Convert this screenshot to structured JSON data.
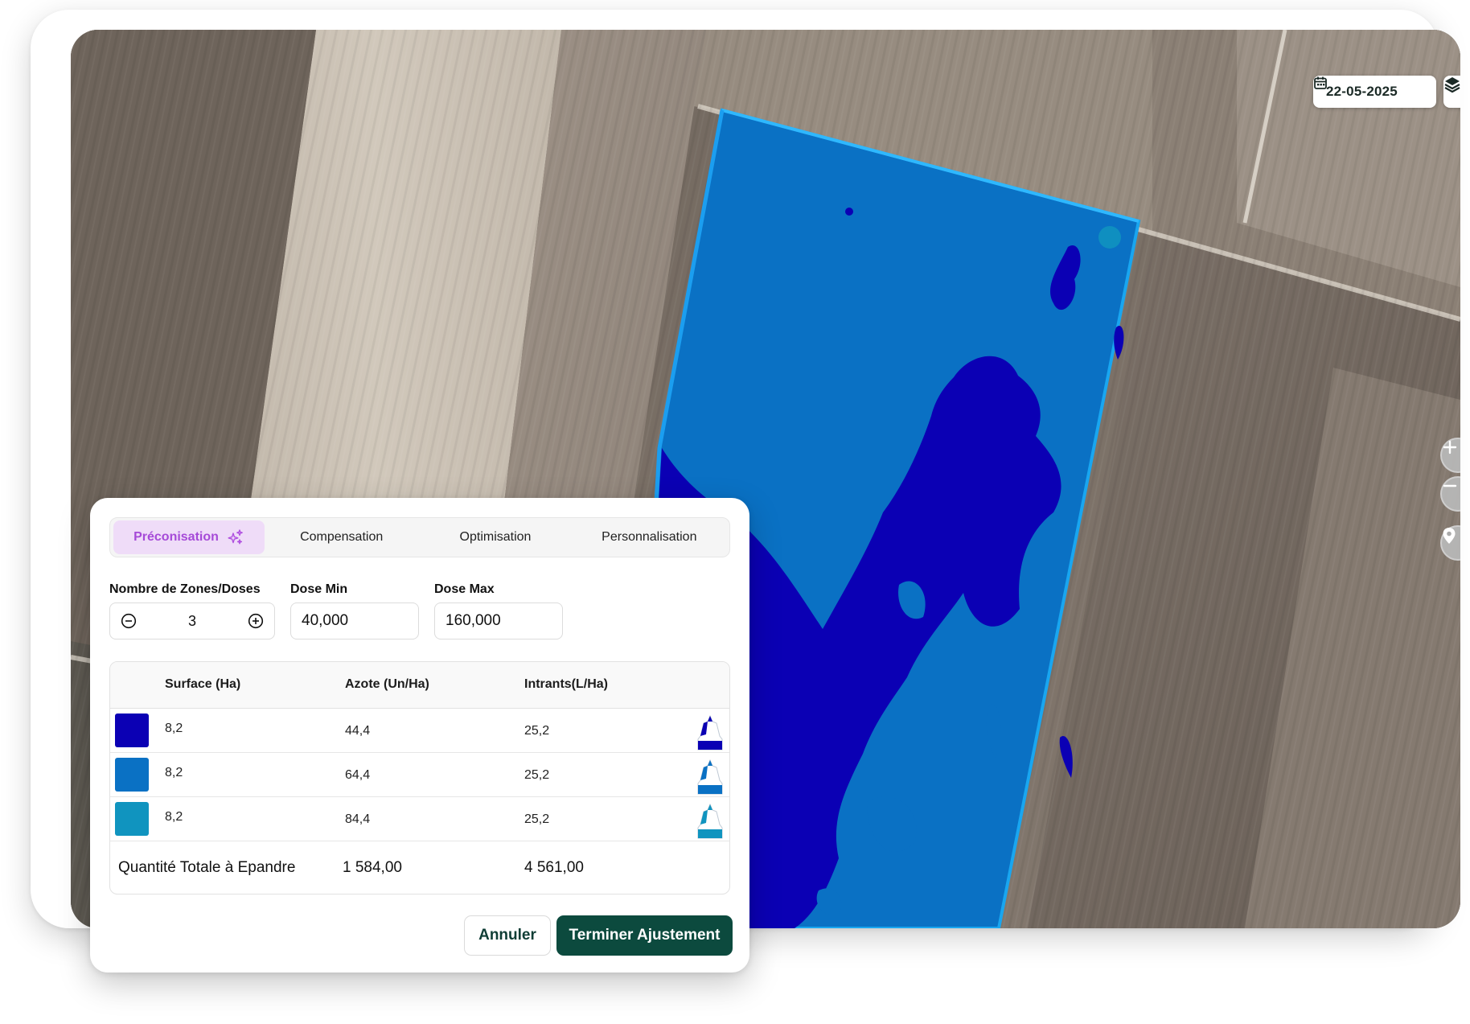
{
  "map": {
    "date": "22-05-2025",
    "date_picker_icon": "calendar-icon",
    "layers_icon": "layers-icon",
    "zoom_in_icon": "plus-icon",
    "zoom_out_icon": "minus-icon",
    "locate_icon": "location-pin-icon",
    "zone_colors": [
      "#0b00b4",
      "#0a71c4",
      "#1094bf"
    ]
  },
  "tabs": [
    {
      "label": "Préconisation",
      "active": true,
      "icon": "sparkles-icon"
    },
    {
      "label": "Compensation",
      "active": false
    },
    {
      "label": "Optimisation",
      "active": false
    },
    {
      "label": "Personnalisation",
      "active": false
    }
  ],
  "params": {
    "zones_label": "Nombre de Zones/Doses",
    "zones_value": "3",
    "dose_min_label": "Dose Min",
    "dose_min_value": "40,000",
    "dose_max_label": "Dose Max",
    "dose_max_value": "160,000"
  },
  "table": {
    "headers": {
      "surface": "Surface (Ha)",
      "azote": "Azote (Un/Ha)",
      "intrants": "Intrants(L/Ha)"
    },
    "rows": [
      {
        "color": "#0b00b4",
        "surface": "8,2",
        "azote": "44,4",
        "intrants": "25,2"
      },
      {
        "color": "#0a71c4",
        "surface": "8,2",
        "azote": "64,4",
        "intrants": "25,2"
      },
      {
        "color": "#1094bf",
        "surface": "8,2",
        "azote": "84,4",
        "intrants": "25,2"
      }
    ],
    "total": {
      "label": "Quantité Totale à Epandre",
      "azote": "1 584,00",
      "intrants": "4 561,00"
    }
  },
  "actions": {
    "cancel": "Annuler",
    "confirm": "Terminer Ajustement"
  }
}
